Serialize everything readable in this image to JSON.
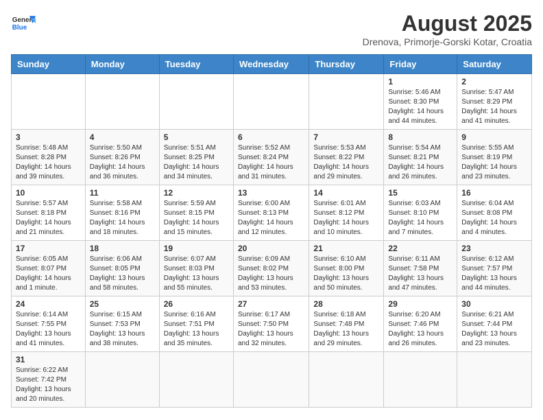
{
  "header": {
    "logo_general": "General",
    "logo_blue": "Blue",
    "month_year": "August 2025",
    "location": "Drenova, Primorje-Gorski Kotar, Croatia"
  },
  "weekdays": [
    "Sunday",
    "Monday",
    "Tuesday",
    "Wednesday",
    "Thursday",
    "Friday",
    "Saturday"
  ],
  "weeks": [
    [
      {
        "day": "",
        "info": ""
      },
      {
        "day": "",
        "info": ""
      },
      {
        "day": "",
        "info": ""
      },
      {
        "day": "",
        "info": ""
      },
      {
        "day": "",
        "info": ""
      },
      {
        "day": "1",
        "info": "Sunrise: 5:46 AM\nSunset: 8:30 PM\nDaylight: 14 hours and 44 minutes."
      },
      {
        "day": "2",
        "info": "Sunrise: 5:47 AM\nSunset: 8:29 PM\nDaylight: 14 hours and 41 minutes."
      }
    ],
    [
      {
        "day": "3",
        "info": "Sunrise: 5:48 AM\nSunset: 8:28 PM\nDaylight: 14 hours and 39 minutes."
      },
      {
        "day": "4",
        "info": "Sunrise: 5:50 AM\nSunset: 8:26 PM\nDaylight: 14 hours and 36 minutes."
      },
      {
        "day": "5",
        "info": "Sunrise: 5:51 AM\nSunset: 8:25 PM\nDaylight: 14 hours and 34 minutes."
      },
      {
        "day": "6",
        "info": "Sunrise: 5:52 AM\nSunset: 8:24 PM\nDaylight: 14 hours and 31 minutes."
      },
      {
        "day": "7",
        "info": "Sunrise: 5:53 AM\nSunset: 8:22 PM\nDaylight: 14 hours and 29 minutes."
      },
      {
        "day": "8",
        "info": "Sunrise: 5:54 AM\nSunset: 8:21 PM\nDaylight: 14 hours and 26 minutes."
      },
      {
        "day": "9",
        "info": "Sunrise: 5:55 AM\nSunset: 8:19 PM\nDaylight: 14 hours and 23 minutes."
      }
    ],
    [
      {
        "day": "10",
        "info": "Sunrise: 5:57 AM\nSunset: 8:18 PM\nDaylight: 14 hours and 21 minutes."
      },
      {
        "day": "11",
        "info": "Sunrise: 5:58 AM\nSunset: 8:16 PM\nDaylight: 14 hours and 18 minutes."
      },
      {
        "day": "12",
        "info": "Sunrise: 5:59 AM\nSunset: 8:15 PM\nDaylight: 14 hours and 15 minutes."
      },
      {
        "day": "13",
        "info": "Sunrise: 6:00 AM\nSunset: 8:13 PM\nDaylight: 14 hours and 12 minutes."
      },
      {
        "day": "14",
        "info": "Sunrise: 6:01 AM\nSunset: 8:12 PM\nDaylight: 14 hours and 10 minutes."
      },
      {
        "day": "15",
        "info": "Sunrise: 6:03 AM\nSunset: 8:10 PM\nDaylight: 14 hours and 7 minutes."
      },
      {
        "day": "16",
        "info": "Sunrise: 6:04 AM\nSunset: 8:08 PM\nDaylight: 14 hours and 4 minutes."
      }
    ],
    [
      {
        "day": "17",
        "info": "Sunrise: 6:05 AM\nSunset: 8:07 PM\nDaylight: 14 hours and 1 minute."
      },
      {
        "day": "18",
        "info": "Sunrise: 6:06 AM\nSunset: 8:05 PM\nDaylight: 13 hours and 58 minutes."
      },
      {
        "day": "19",
        "info": "Sunrise: 6:07 AM\nSunset: 8:03 PM\nDaylight: 13 hours and 55 minutes."
      },
      {
        "day": "20",
        "info": "Sunrise: 6:09 AM\nSunset: 8:02 PM\nDaylight: 13 hours and 53 minutes."
      },
      {
        "day": "21",
        "info": "Sunrise: 6:10 AM\nSunset: 8:00 PM\nDaylight: 13 hours and 50 minutes."
      },
      {
        "day": "22",
        "info": "Sunrise: 6:11 AM\nSunset: 7:58 PM\nDaylight: 13 hours and 47 minutes."
      },
      {
        "day": "23",
        "info": "Sunrise: 6:12 AM\nSunset: 7:57 PM\nDaylight: 13 hours and 44 minutes."
      }
    ],
    [
      {
        "day": "24",
        "info": "Sunrise: 6:14 AM\nSunset: 7:55 PM\nDaylight: 13 hours and 41 minutes."
      },
      {
        "day": "25",
        "info": "Sunrise: 6:15 AM\nSunset: 7:53 PM\nDaylight: 13 hours and 38 minutes."
      },
      {
        "day": "26",
        "info": "Sunrise: 6:16 AM\nSunset: 7:51 PM\nDaylight: 13 hours and 35 minutes."
      },
      {
        "day": "27",
        "info": "Sunrise: 6:17 AM\nSunset: 7:50 PM\nDaylight: 13 hours and 32 minutes."
      },
      {
        "day": "28",
        "info": "Sunrise: 6:18 AM\nSunset: 7:48 PM\nDaylight: 13 hours and 29 minutes."
      },
      {
        "day": "29",
        "info": "Sunrise: 6:20 AM\nSunset: 7:46 PM\nDaylight: 13 hours and 26 minutes."
      },
      {
        "day": "30",
        "info": "Sunrise: 6:21 AM\nSunset: 7:44 PM\nDaylight: 13 hours and 23 minutes."
      }
    ],
    [
      {
        "day": "31",
        "info": "Sunrise: 6:22 AM\nSunset: 7:42 PM\nDaylight: 13 hours and 20 minutes."
      },
      {
        "day": "",
        "info": ""
      },
      {
        "day": "",
        "info": ""
      },
      {
        "day": "",
        "info": ""
      },
      {
        "day": "",
        "info": ""
      },
      {
        "day": "",
        "info": ""
      },
      {
        "day": "",
        "info": ""
      }
    ]
  ]
}
